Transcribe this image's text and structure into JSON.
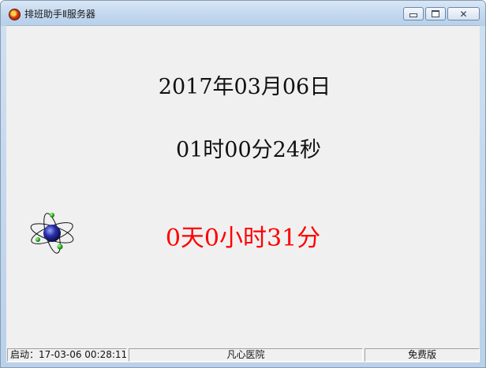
{
  "window": {
    "title": "排班助手Ⅱ服务器",
    "icon": "app-logo-icon"
  },
  "main": {
    "date": "2017年03月06日",
    "time": "01时00分24秒",
    "uptime": "0天0小时31分",
    "uptime_color": "#ff0000",
    "animation_icon": "atom-icon"
  },
  "statusbar": {
    "start_time": "启动：17-03-06 00:28:11",
    "hospital": "凡心医院",
    "edition": "免费版"
  }
}
